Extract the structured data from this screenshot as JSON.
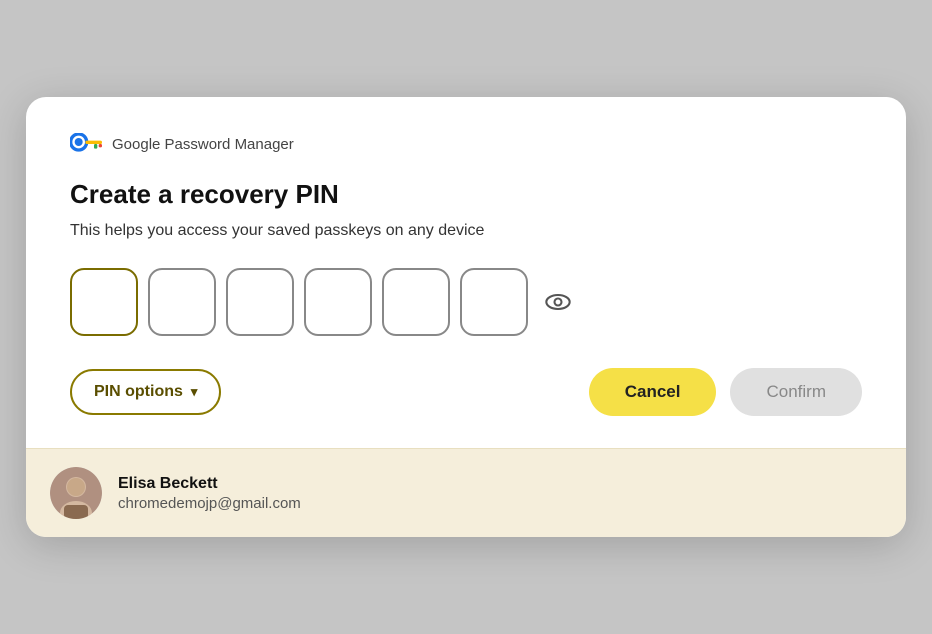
{
  "modal": {
    "header": {
      "brand": "Google Password Manager",
      "title": "Create a recovery PIN",
      "subtitle": "This helps you access your saved passkeys on any device"
    },
    "pin": {
      "boxes": [
        "",
        "",
        "",
        "",
        "",
        ""
      ],
      "placeholder": ""
    },
    "actions": {
      "pin_options_label": "PIN options",
      "cancel_label": "Cancel",
      "confirm_label": "Confirm"
    },
    "footer": {
      "user_name": "Elisa Beckett",
      "user_email": "chromedemojp@gmail.com"
    }
  },
  "icons": {
    "eye": "👁",
    "chevron_down": "▾"
  }
}
